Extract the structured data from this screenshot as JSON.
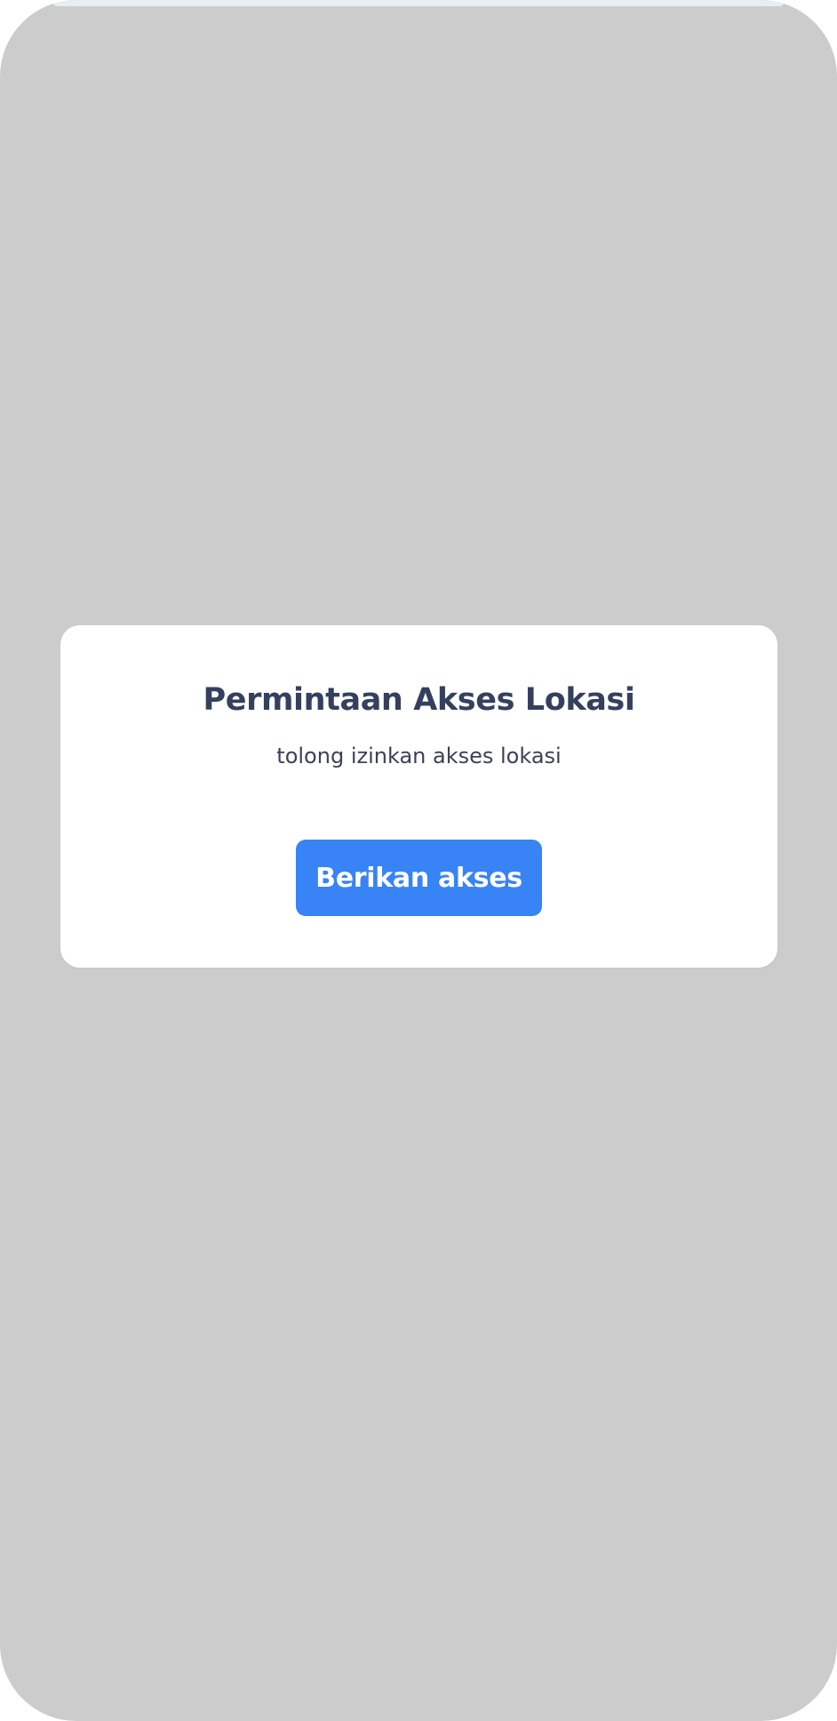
{
  "dialog": {
    "title": "Permintaan Akses Lokasi",
    "message": "tolong izinkan akses lokasi",
    "grant_button_label": "Berikan akses"
  },
  "colors": {
    "overlay": "#cccccc",
    "card": "#ffffff",
    "title_text": "#34405d",
    "button": "#3883f5",
    "button_text": "#ffffff"
  }
}
